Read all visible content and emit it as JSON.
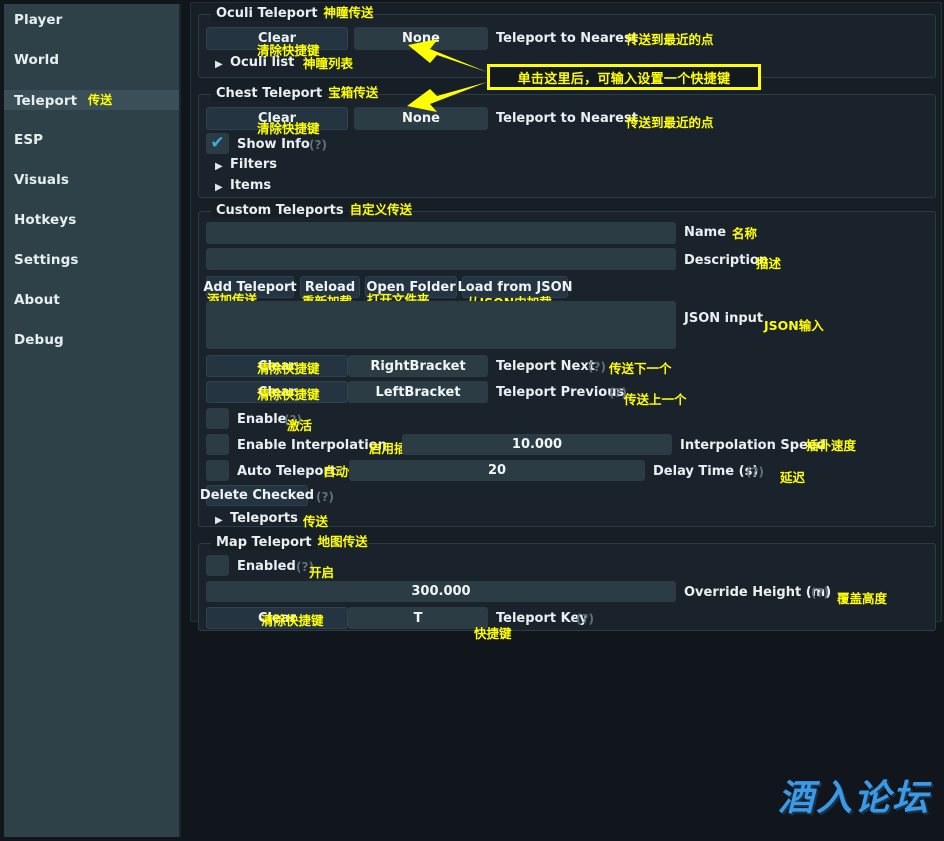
{
  "sidebar": {
    "items": [
      {
        "label": "Player",
        "cn": "",
        "selected": false
      },
      {
        "label": "World",
        "cn": "",
        "selected": false
      },
      {
        "label": "Teleport",
        "cn": "传送",
        "selected": true
      },
      {
        "label": "ESP",
        "cn": "",
        "selected": false
      },
      {
        "label": "Visuals",
        "cn": "",
        "selected": false
      },
      {
        "label": "Hotkeys",
        "cn": "",
        "selected": false
      },
      {
        "label": "Settings",
        "cn": "",
        "selected": false
      },
      {
        "label": "About",
        "cn": "",
        "selected": false
      },
      {
        "label": "Debug",
        "cn": "",
        "selected": false
      }
    ]
  },
  "oculi_group": {
    "title": "Oculi Teleport",
    "title_cn": "神瞳传送",
    "clear_button": "Clear",
    "clear_cn": "清除快捷键",
    "hotkey_value": "None",
    "action_label": "Teleport to Nearest",
    "action_cn": "传送到最近的点",
    "list_label": "Oculi list",
    "list_cn": "神瞳列表"
  },
  "chest_group": {
    "title": "Chest Teleport",
    "title_cn": "宝箱传送",
    "clear_button": "Clear",
    "clear_cn": "清除快捷键",
    "hotkey_value": "None",
    "action_label": "Teleport to Nearest",
    "action_cn": "传送到最近的点",
    "show_info_label": "Show Info",
    "show_info_hint": "(?)",
    "show_info_checked": true,
    "filters_label": "Filters",
    "items_label": "Items"
  },
  "custom_group": {
    "title": "Custom Teleports",
    "title_cn": "自定义传送",
    "name_value": "",
    "name_label": "Name",
    "name_cn": "名称",
    "description_value": "",
    "description_label": "Description",
    "description_cn": "描述",
    "json_label": "JSON input",
    "json_cn": "JSON输入",
    "json_value": "",
    "buttons": [
      {
        "label": "Add Teleport",
        "cn": "添加传送"
      },
      {
        "label": "Reload",
        "cn": "重新加载"
      },
      {
        "label": "Open Folder",
        "cn": "打开文件夹"
      },
      {
        "label": "Load from JSON",
        "cn": "从JSON中加载"
      }
    ],
    "next": {
      "clear": "Clear",
      "clear_cn": "清除快捷键",
      "value": "RightBracket",
      "label": "Teleport Next",
      "hint": "(?)",
      "cn": "传送下一个"
    },
    "previous": {
      "clear": "Clear",
      "clear_cn": "清除快捷键",
      "value": "LeftBracket",
      "label": "Teleport Previous",
      "hint": "(?)",
      "cn": "传送上一个"
    },
    "enable": {
      "label": "Enable",
      "hint": "(?)",
      "cn": "激活",
      "checked": false
    },
    "interpolation": {
      "label": "Enable Interpolation",
      "hint": "(?)",
      "cn": "启用插值",
      "checked": false,
      "value": "10.000",
      "slider_label": "Interpolation Speed",
      "slider_cn": "插补速度"
    },
    "auto_teleport": {
      "label": "Auto Teleport",
      "cn": "自动传送",
      "checked": false,
      "value": "20",
      "slider_label": "Delay Time (s)",
      "slider_hint": "(?)",
      "slider_cn": "延迟"
    },
    "delete_checked": {
      "label": "Delete Checked",
      "hint": "(?)"
    },
    "teleports_tree": {
      "label": "Teleports",
      "cn": "传送"
    }
  },
  "map_group": {
    "title": "Map Teleport",
    "title_cn": "地图传送",
    "enabled": {
      "label": "Enabled",
      "hint": "(?)",
      "cn": "开启",
      "checked": false
    },
    "height": {
      "value": "300.000",
      "label": "Override Height (m)",
      "hint": "(?)",
      "cn": "覆盖高度"
    },
    "key": {
      "clear": "Clear",
      "clear_cn": "清除快捷键",
      "value": "T",
      "label": "Teleport Key",
      "hint": "(?)",
      "cn": "快捷键"
    }
  },
  "annotation": {
    "tooltip_text": "单击这里后，可输入设置一个快捷键",
    "arrow_color": "#ffff00"
  },
  "watermark": {
    "text": "酒入论坛",
    "color": "#3b9ae8"
  }
}
